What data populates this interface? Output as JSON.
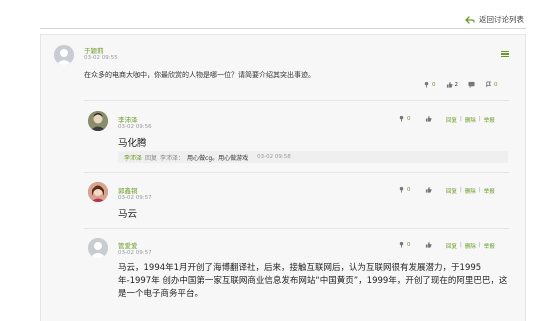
{
  "header": {
    "back_label": "返回讨论列表"
  },
  "main_post": {
    "author": "于颖莉",
    "time": "03-02 09:55",
    "text": "在众多的电商大咖中，你最欣赏的人物是哪一位？请简要介绍其突出事迹。",
    "flowers": "0",
    "likes": "2",
    "comments": "",
    "favorites": "0"
  },
  "replies": [
    {
      "author": "李沛泽",
      "time": "03-02 09:56",
      "text": "马化腾",
      "flowers": "0",
      "likes": "",
      "links": [
        "回复",
        "删除",
        "举报"
      ],
      "nested": {
        "author": "李沛泽",
        "reply_word": "回复",
        "target": "李沛泽：",
        "text": "用心做cg。用心做游戏",
        "time": "03-02 09:58"
      }
    },
    {
      "author": "郭鑫铜",
      "time": "03-02 09:57",
      "text": "马云",
      "flowers": "0",
      "likes": "",
      "links": [
        "回复",
        "删除",
        "举报"
      ]
    },
    {
      "author": "管爱爱",
      "time": "03-02 09:57",
      "text": "马云，1994年1月开创了海博翻译社，后来，接触互联网后，认为互联网很有发展潜力，于1995年-1997年 创办中国第一家互联网商业信息发布网站“中国黄页”，1999年，开创了现在的阿里巴巴，这是一个电子商务平台。",
      "flowers": "0",
      "likes": "",
      "links": [
        "回复",
        "删除",
        "举报"
      ]
    }
  ],
  "colors": {
    "accent": "#6a9a24",
    "background": "#f7f7f7"
  },
  "icons": [
    "back-arrow-icon",
    "menu-icon",
    "flower-icon",
    "thumbs-up-icon",
    "comment-icon",
    "favorite-icon"
  ]
}
